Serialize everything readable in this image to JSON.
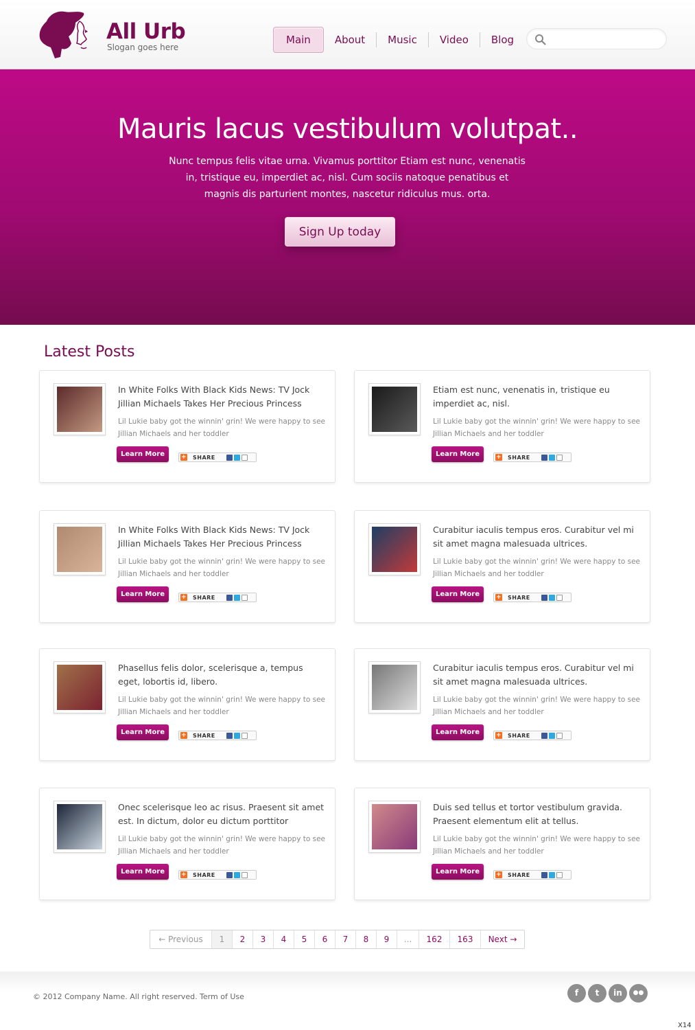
{
  "brand": {
    "title": "All Urb",
    "slogan": "Slogan goes here",
    "accent": "#7a0c52",
    "hero_color": "#b00a7e"
  },
  "nav": {
    "items": [
      {
        "label": "Main",
        "active": true
      },
      {
        "label": "About",
        "active": false
      },
      {
        "label": "Music",
        "active": false
      },
      {
        "label": "Video",
        "active": false
      },
      {
        "label": "Blog",
        "active": false
      }
    ],
    "search_placeholder": ""
  },
  "hero": {
    "title": "Mauris lacus vestibulum volutpat..",
    "text": "Nunc tempus felis vitae urna. Vivamus porttitor Etiam est nunc, venenatis in, tristique eu, imperdiet ac, nisl. Cum sociis natoque penatibus et magnis dis parturient montes, nascetur ridiculus mus. orta.",
    "button": "Sign Up today"
  },
  "latest": {
    "title": "Latest Posts",
    "learn_more": "Learn More",
    "share": "SHARE",
    "posts": [
      {
        "title": "In White Folks With Black Kids News: TV Jock Jillian Michaels Takes Her Precious Princess",
        "excerpt": "Lil Lukie baby got the winnin' grin! We were happy to see Jillian Michaels and her toddler"
      },
      {
        "title": "Etiam est nunc, venenatis in, tristique eu imperdiet ac, nisl.",
        "excerpt": "Lil Lukie baby got the winnin' grin! We were happy to see Jillian Michaels and her toddler"
      },
      {
        "title": "In White Folks With Black Kids News: TV Jock Jillian Michaels Takes Her Precious Princess",
        "excerpt": "Lil Lukie baby got the winnin' grin! We were happy to see Jillian Michaels and her toddler"
      },
      {
        "title": "Curabitur iaculis tempus eros. Curabitur vel mi sit amet magna malesuada ultrices.",
        "excerpt": "Lil Lukie baby got the winnin' grin! We were happy to see Jillian Michaels and her toddler"
      },
      {
        "title": "Phasellus felis dolor, scelerisque a, tempus eget, lobortis id, libero.",
        "excerpt": "Lil Lukie baby got the winnin' grin! We were happy to see Jillian Michaels and her toddler"
      },
      {
        "title": "Curabitur iaculis tempus eros. Curabitur vel mi sit amet magna malesuada ultrices.",
        "excerpt": "Lil Lukie baby got the winnin' grin! We were happy to see Jillian Michaels and her toddler"
      },
      {
        "title": "Onec scelerisque leo ac risus. Praesent sit amet est. In dictum, dolor eu dictum porttitor",
        "excerpt": "Lil Lukie baby got the winnin' grin! We were happy to see Jillian Michaels and her toddler"
      },
      {
        "title": "Duis sed tellus et tortor vestibulum gravida. Praesent elementum elit at tellus.",
        "excerpt": "Lil Lukie baby got the winnin' grin! We were happy to see Jillian Michaels and her toddler"
      }
    ]
  },
  "pagination": {
    "previous": "← Previous",
    "current": "1",
    "pages": [
      "2",
      "3",
      "4",
      "5",
      "6",
      "7",
      "8",
      "9"
    ],
    "ellipsis": "...",
    "last_pages": [
      "162",
      "163"
    ],
    "next": "Next →"
  },
  "footer": {
    "copyright": "© 2012 Company Name.  All right reserved.  Term of Use",
    "socials": [
      {
        "icon": "facebook-icon",
        "glyph": "f"
      },
      {
        "icon": "twitter-icon",
        "glyph": "t"
      },
      {
        "icon": "linkedin-icon",
        "glyph": "in"
      },
      {
        "icon": "flickr-icon",
        "glyph": "●●"
      }
    ],
    "badge": "X14"
  }
}
